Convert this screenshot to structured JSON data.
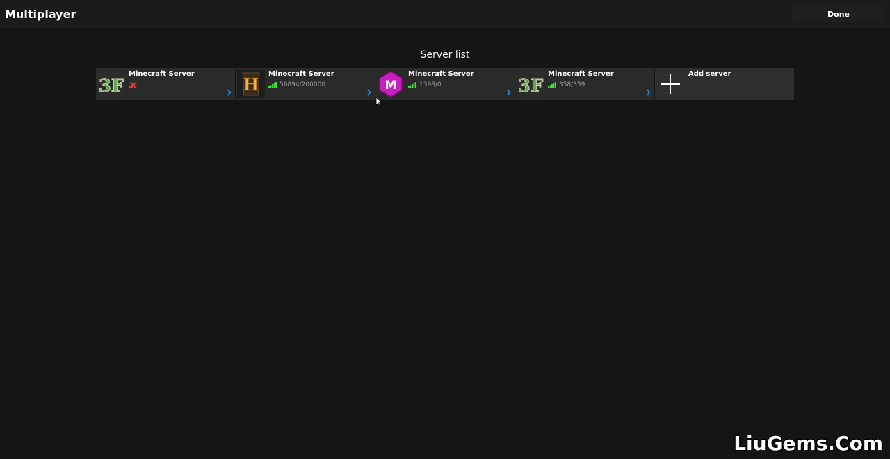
{
  "header": {
    "title": "Multiplayer",
    "done_label": "Done"
  },
  "server_list": {
    "title": "Server list",
    "servers": [
      {
        "name": "Minecraft Server",
        "players": "",
        "status": "offline",
        "icon": "3f-logo-icon"
      },
      {
        "name": "Minecraft Server",
        "players": "56894/200000",
        "status": "online",
        "icon": "hypixel-logo-icon"
      },
      {
        "name": "Minecraft Server",
        "players": "1398/0",
        "status": "online",
        "icon": "mineplex-logo-icon"
      },
      {
        "name": "Minecraft Server",
        "players": "358/359",
        "status": "online",
        "icon": "3f-logo-icon"
      }
    ],
    "add_server_label": "Add server"
  },
  "watermark": "LiuGems.Com",
  "colors": {
    "background": "#151515",
    "topbar": "#1b1b1b",
    "card": "#2a2a2a",
    "signal_online": "#3ddc3d",
    "signal_offline": "#e53935",
    "chevron": "#2b8ce6"
  }
}
